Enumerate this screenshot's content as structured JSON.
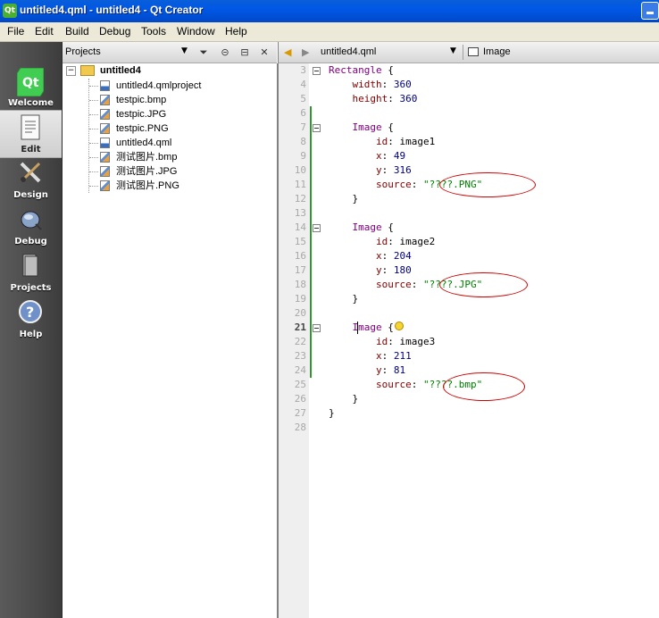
{
  "window": {
    "title": "untitled4.qml - untitled4 - Qt Creator"
  },
  "menu": [
    "File",
    "Edit",
    "Build",
    "Debug",
    "Tools",
    "Window",
    "Help"
  ],
  "modes": [
    {
      "label": "Welcome",
      "icon": "qt-logo-icon"
    },
    {
      "label": "Edit",
      "icon": "edit-document-icon",
      "active": true
    },
    {
      "label": "Design",
      "icon": "design-brush-icon"
    },
    {
      "label": "Debug",
      "icon": "debug-bug-icon"
    },
    {
      "label": "Projects",
      "icon": "projects-book-icon"
    },
    {
      "label": "Help",
      "icon": "help-icon"
    }
  ],
  "projects": {
    "header": "Projects",
    "root": "untitled4",
    "files": [
      {
        "name": "untitled4.qmlproject",
        "icon": "qmlproject-file-icon"
      },
      {
        "name": "testpic.bmp",
        "icon": "image-file-icon"
      },
      {
        "name": "testpic.JPG",
        "icon": "image-file-icon"
      },
      {
        "name": "testpic.PNG",
        "icon": "image-file-icon"
      },
      {
        "name": "untitled4.qml",
        "icon": "qml-file-icon"
      },
      {
        "name": "测试图片.bmp",
        "icon": "image-file-icon"
      },
      {
        "name": "测试图片.JPG",
        "icon": "image-file-icon"
      },
      {
        "name": "测试图片.PNG",
        "icon": "image-file-icon"
      }
    ]
  },
  "editor": {
    "filename": "untitled4.qml",
    "symbol": "Image",
    "current_line": 21,
    "lines": [
      {
        "n": "3",
        "t": [
          [
            "ty",
            "Rectangle"
          ],
          [
            "",
            " {"
          ]
        ]
      },
      {
        "n": "4",
        "t": [
          [
            "",
            "    "
          ],
          [
            "pr",
            "width"
          ],
          [
            "",
            ": "
          ],
          [
            "nm",
            "360"
          ]
        ]
      },
      {
        "n": "5",
        "t": [
          [
            "",
            "    "
          ],
          [
            "pr",
            "height"
          ],
          [
            "",
            ": "
          ],
          [
            "nm",
            "360"
          ]
        ]
      },
      {
        "n": "6",
        "t": []
      },
      {
        "n": "7",
        "t": [
          [
            "",
            "    "
          ],
          [
            "ty",
            "Image"
          ],
          [
            "",
            " {"
          ]
        ]
      },
      {
        "n": "8",
        "t": [
          [
            "",
            "        "
          ],
          [
            "pr",
            "id"
          ],
          [
            "",
            ": "
          ],
          [
            "",
            "image1"
          ]
        ]
      },
      {
        "n": "9",
        "t": [
          [
            "",
            "        "
          ],
          [
            "pr",
            "x"
          ],
          [
            "",
            ": "
          ],
          [
            "nm",
            "49"
          ]
        ]
      },
      {
        "n": "10",
        "t": [
          [
            "",
            "        "
          ],
          [
            "pr",
            "y"
          ],
          [
            "",
            ": "
          ],
          [
            "nm",
            "316"
          ]
        ]
      },
      {
        "n": "11",
        "t": [
          [
            "",
            "        "
          ],
          [
            "pr",
            "source"
          ],
          [
            "",
            ": "
          ],
          [
            "st",
            "\"????.PNG\""
          ]
        ]
      },
      {
        "n": "12",
        "t": [
          [
            "",
            "    }"
          ]
        ]
      },
      {
        "n": "13",
        "t": []
      },
      {
        "n": "14",
        "t": [
          [
            "",
            "    "
          ],
          [
            "ty",
            "Image"
          ],
          [
            "",
            " {"
          ]
        ]
      },
      {
        "n": "15",
        "t": [
          [
            "",
            "        "
          ],
          [
            "pr",
            "id"
          ],
          [
            "",
            ": "
          ],
          [
            "",
            "image2"
          ]
        ]
      },
      {
        "n": "16",
        "t": [
          [
            "",
            "        "
          ],
          [
            "pr",
            "x"
          ],
          [
            "",
            ": "
          ],
          [
            "nm",
            "204"
          ]
        ]
      },
      {
        "n": "17",
        "t": [
          [
            "",
            "        "
          ],
          [
            "pr",
            "y"
          ],
          [
            "",
            ": "
          ],
          [
            "nm",
            "180"
          ]
        ]
      },
      {
        "n": "18",
        "t": [
          [
            "",
            "        "
          ],
          [
            "pr",
            "source"
          ],
          [
            "",
            ": "
          ],
          [
            "st",
            "\"????.JPG\""
          ]
        ]
      },
      {
        "n": "19",
        "t": [
          [
            "",
            "    }"
          ]
        ]
      },
      {
        "n": "20",
        "t": []
      },
      {
        "n": "21",
        "t": [
          [
            "",
            "    "
          ],
          [
            "ty",
            "Image"
          ],
          [
            "",
            " {"
          ]
        ]
      },
      {
        "n": "22",
        "t": [
          [
            "",
            "        "
          ],
          [
            "pr",
            "id"
          ],
          [
            "",
            ": "
          ],
          [
            "",
            "image3"
          ]
        ]
      },
      {
        "n": "23",
        "t": [
          [
            "",
            "        "
          ],
          [
            "pr",
            "x"
          ],
          [
            "",
            ": "
          ],
          [
            "nm",
            "211"
          ]
        ]
      },
      {
        "n": "24",
        "t": [
          [
            "",
            "        "
          ],
          [
            "pr",
            "y"
          ],
          [
            "",
            ": "
          ],
          [
            "nm",
            "81"
          ]
        ]
      },
      {
        "n": "25",
        "t": [
          [
            "",
            "        "
          ],
          [
            "pr",
            "source"
          ],
          [
            "",
            ": "
          ],
          [
            "st",
            "\"????.bmp\""
          ]
        ]
      },
      {
        "n": "26",
        "t": [
          [
            "",
            "    }"
          ]
        ]
      },
      {
        "n": "27",
        "t": [
          [
            "",
            "}"
          ]
        ]
      },
      {
        "n": "28",
        "t": []
      }
    ]
  },
  "colors": {
    "annotation": "#d00000",
    "string": "#008000",
    "type": "#800080",
    "property": "#800000",
    "number": "#000080"
  }
}
